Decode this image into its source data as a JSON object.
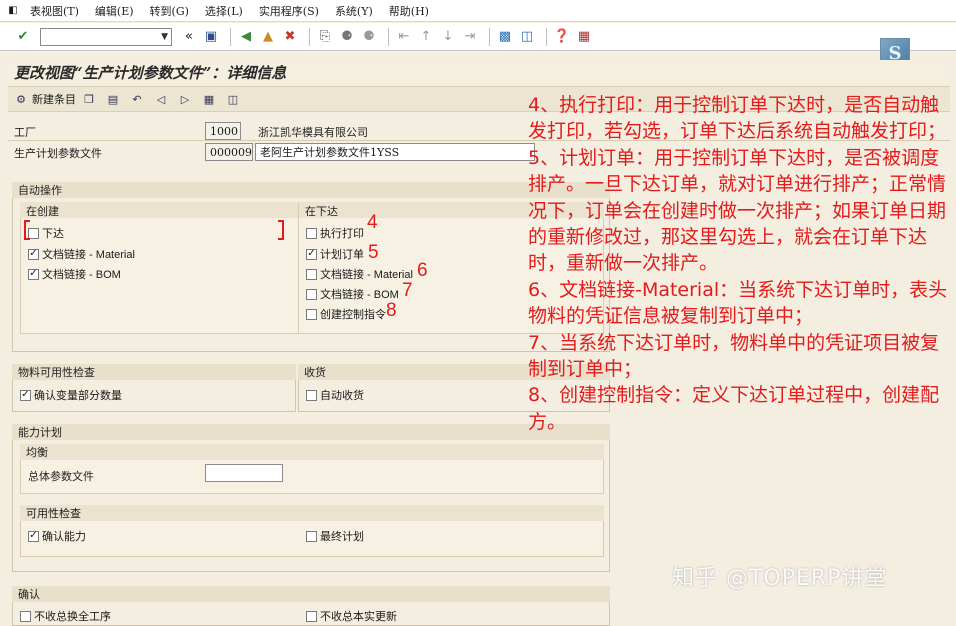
{
  "menubar": {
    "items": [
      "表视图(T)",
      "编辑(E)",
      "转到(G)",
      "选择(L)",
      "实用程序(S)",
      "系统(Y)",
      "帮助(H)"
    ]
  },
  "toolbar": {
    "command_value": "",
    "icons": [
      "check-icon",
      "back-double-icon",
      "save-icon",
      "back-icon",
      "exit-icon",
      "cancel-icon",
      "print-icon",
      "find-icon",
      "find-next-icon",
      "first-page-icon",
      "prev-page-icon",
      "next-page-icon",
      "last-page-icon",
      "new-session-icon",
      "shortcut-icon",
      "help-icon",
      "layout-icon"
    ]
  },
  "title": "更改视图“生产计划参数文件”：详细信息",
  "appbar": {
    "new_entry": "新建条目"
  },
  "header": {
    "plant_label": "工厂",
    "plant_value": "1000",
    "plant_name": "浙江凯华模具有限公司",
    "profile_label": "生产计划参数文件",
    "profile_value": "000009",
    "profile_name": "老阿生产计划参数文件1YSS"
  },
  "auto_ops": {
    "title": "自动操作",
    "on_create": {
      "title": "在创建",
      "items": [
        {
          "label": "下达",
          "checked": false
        },
        {
          "label": "文档链接 - Material",
          "checked": true
        },
        {
          "label": "文档链接 - BOM",
          "checked": true
        }
      ]
    },
    "on_release": {
      "title": "在下达",
      "items": [
        {
          "label": "执行打印",
          "checked": false,
          "mark": "4"
        },
        {
          "label": "计划订单",
          "checked": true,
          "mark": "5"
        },
        {
          "label": "文档链接 - Material",
          "checked": false,
          "mark": "6"
        },
        {
          "label": "文档链接 - BOM",
          "checked": false,
          "mark": "7"
        },
        {
          "label": "创建控制指令",
          "checked": false,
          "mark": "8"
        }
      ]
    }
  },
  "availability": {
    "title": "物料可用性检查",
    "item": {
      "label": "确认变量部分数量",
      "checked": true
    },
    "gr_title": "收货",
    "gr_item": {
      "label": "自动收货",
      "checked": false
    }
  },
  "capacity": {
    "title": "能力计划",
    "leveling_title": "均衡",
    "overall_profile_label": "总体参数文件",
    "overall_profile_value": "",
    "avail_check_title": "可用性检查",
    "confirm_capacity": {
      "label": "确认能力",
      "checked": true
    },
    "finite_sched": {
      "label": "最终计划",
      "checked": false
    }
  },
  "confirmation": {
    "title": "确认",
    "item1": "不收总换全工序",
    "item2": "不收总本实更新"
  },
  "annotation": [
    "4、执行打印：用于控制订单下达时，是否自动触发打印，若勾选，订单下达后系统自动触发打印；",
    "5、计划订单：用于控制订单下达时，是否被调度排产。一旦下达订单，就对订单进行排产；正常情况下，订单会在创建时做一次排产；如果订单日期的重新修改过，那这里勾选上，就会在订单下达时，重新做一次排产。",
    "6、文档链接-Material：当系统下达订单时，表头物料的凭证信息被复制到订单中；",
    "7、当系统下达订单时，物料单中的凭证项目被复制到订单中；",
    "8、创建控制指令：定义下达订单过程中，创建配方。"
  ],
  "watermark": "知乎 @TOPERP讲堂",
  "colors": {
    "annotation_red": "#e31b1b",
    "sap_background": "#f3eee0"
  }
}
